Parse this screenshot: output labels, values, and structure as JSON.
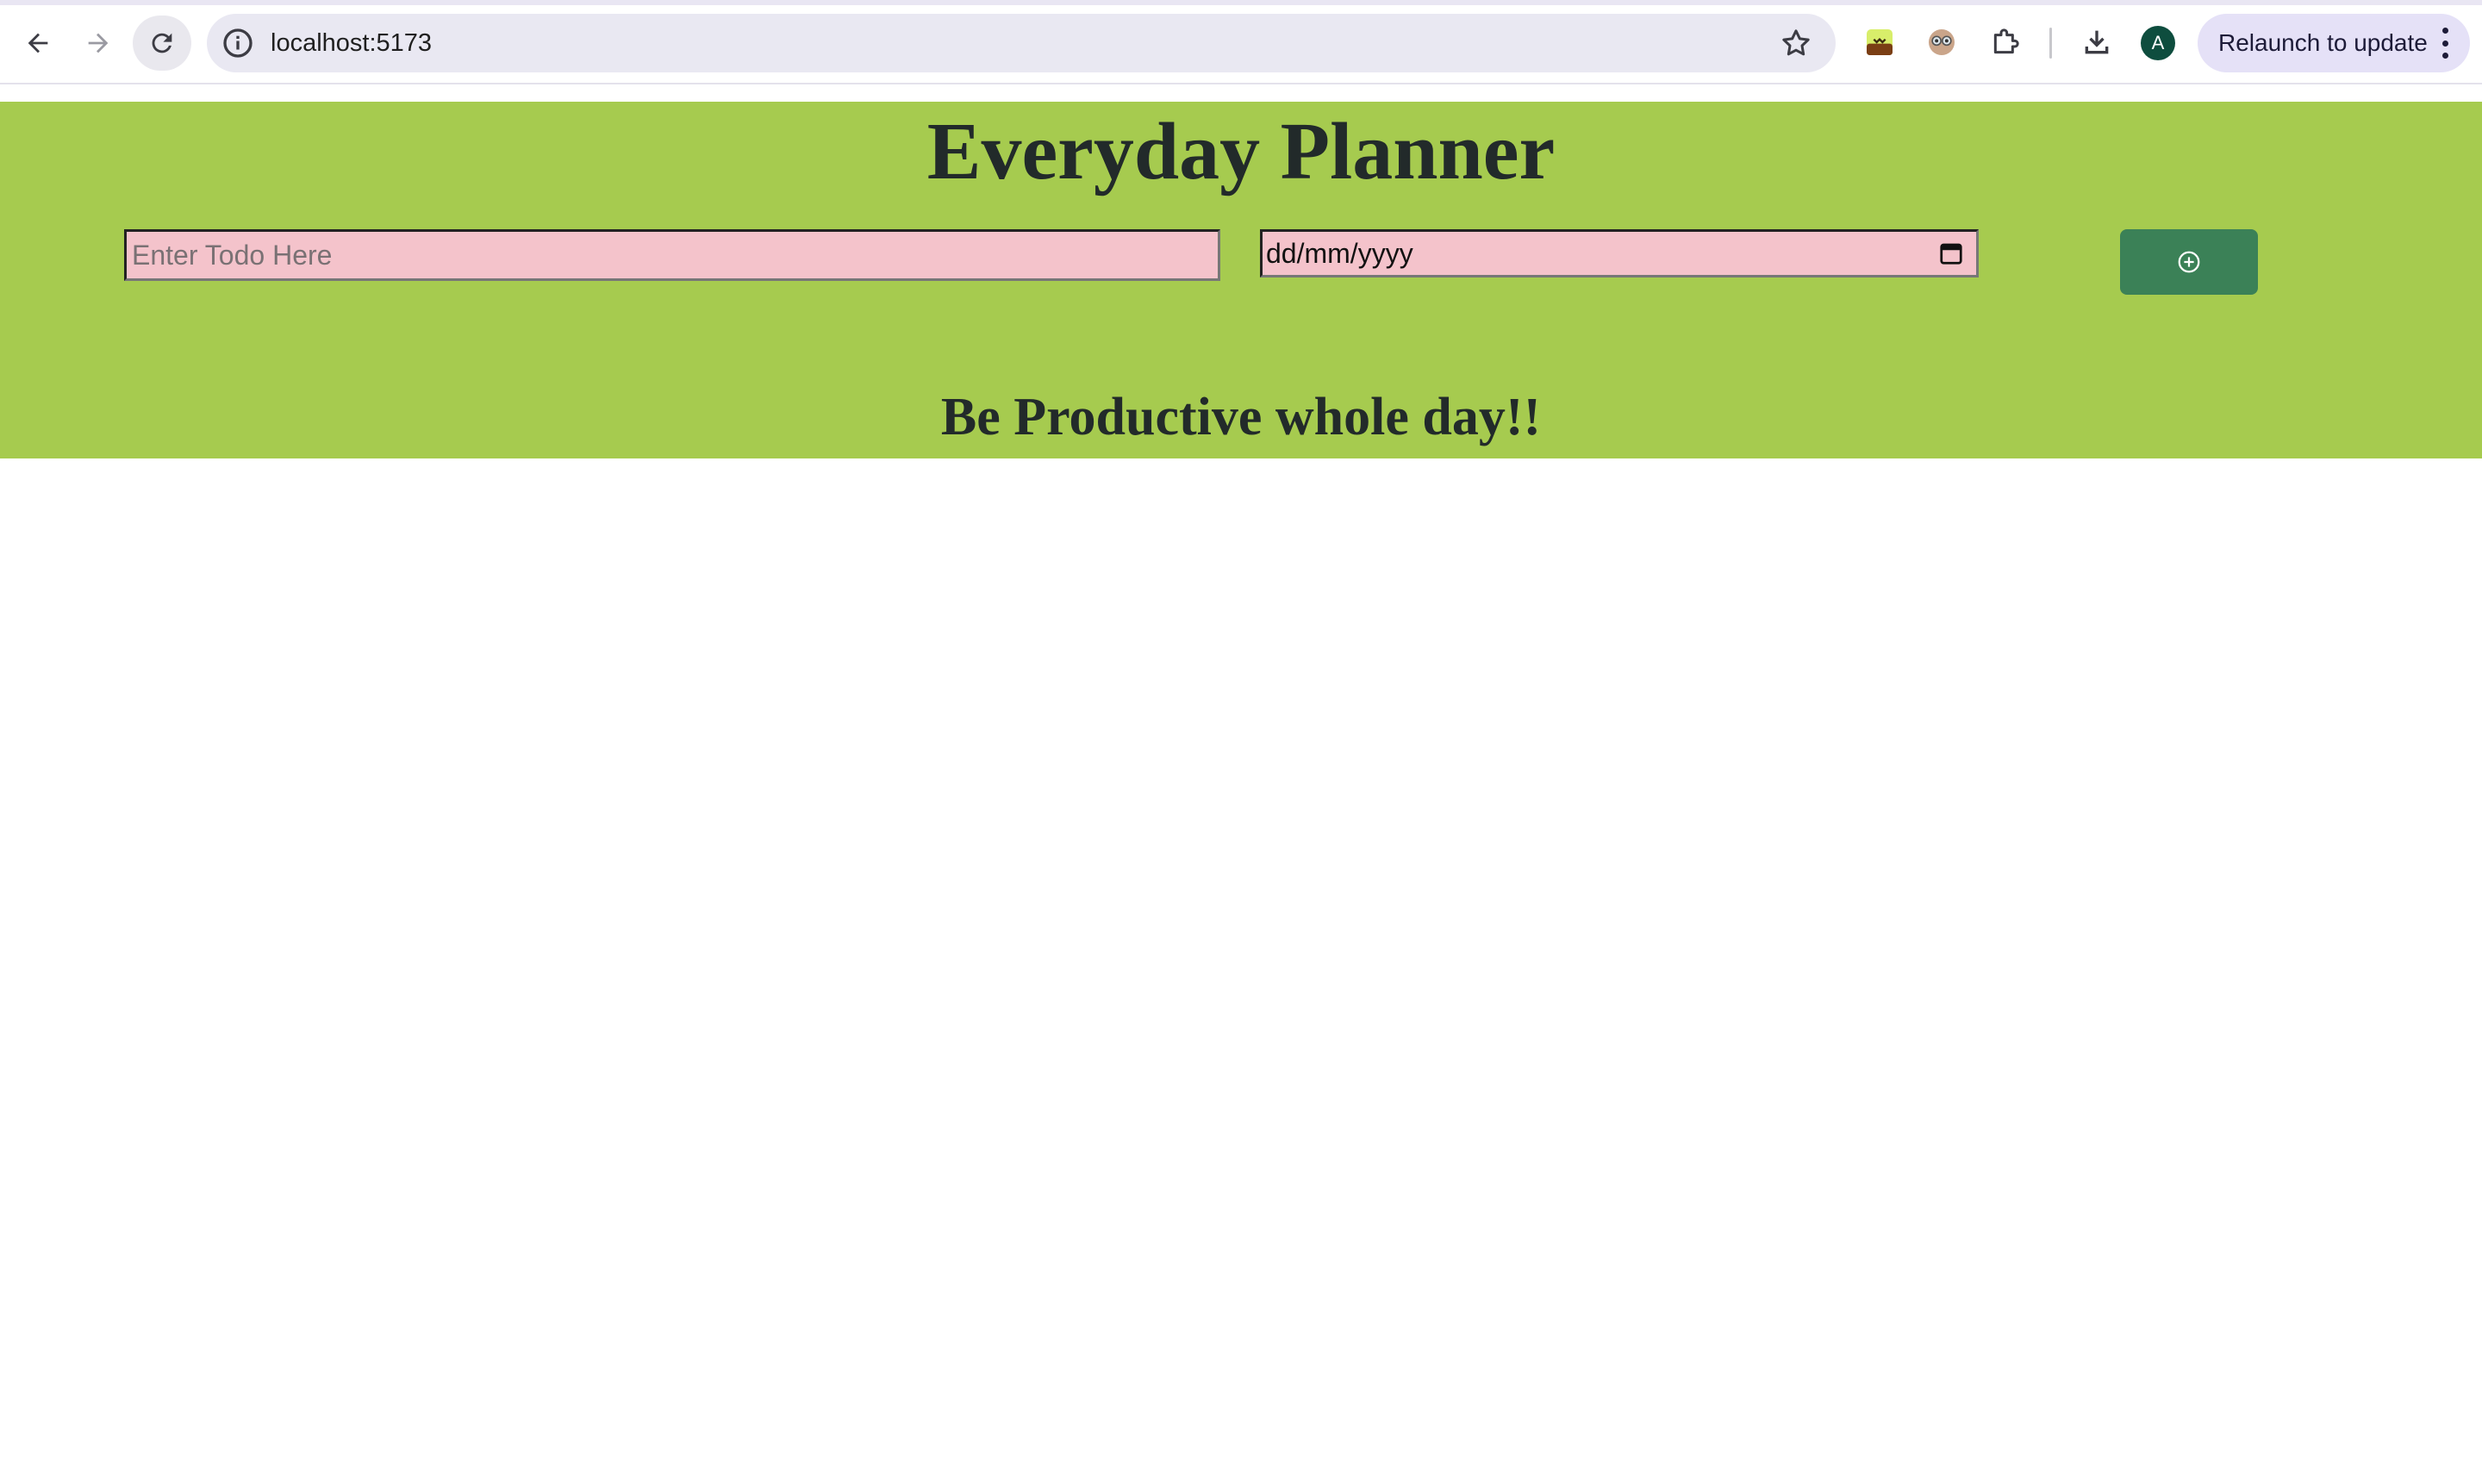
{
  "browser": {
    "url": "localhost:5173",
    "profile_initial": "A",
    "relaunch_label": "Relaunch to update",
    "icons": [
      "back-arrow-icon",
      "forward-arrow-icon",
      "reload-icon",
      "site-info-icon",
      "bookmark-star-icon",
      "extension-icon",
      "extension-icon",
      "extensions-puzzle-icon",
      "download-icon",
      "more-vert-icon"
    ]
  },
  "page": {
    "title": "Everyday Planner",
    "todo_placeholder": "Enter Todo Here",
    "date_placeholder": "dd/mm/yyyy",
    "add_button_icon": "add-circle-icon",
    "tagline": "Be Productive whole day!!",
    "colors": {
      "banner": "#a6cb4f",
      "input_bg": "#f4c3cb",
      "button": "#3b8157",
      "text": "#222a2a"
    }
  }
}
